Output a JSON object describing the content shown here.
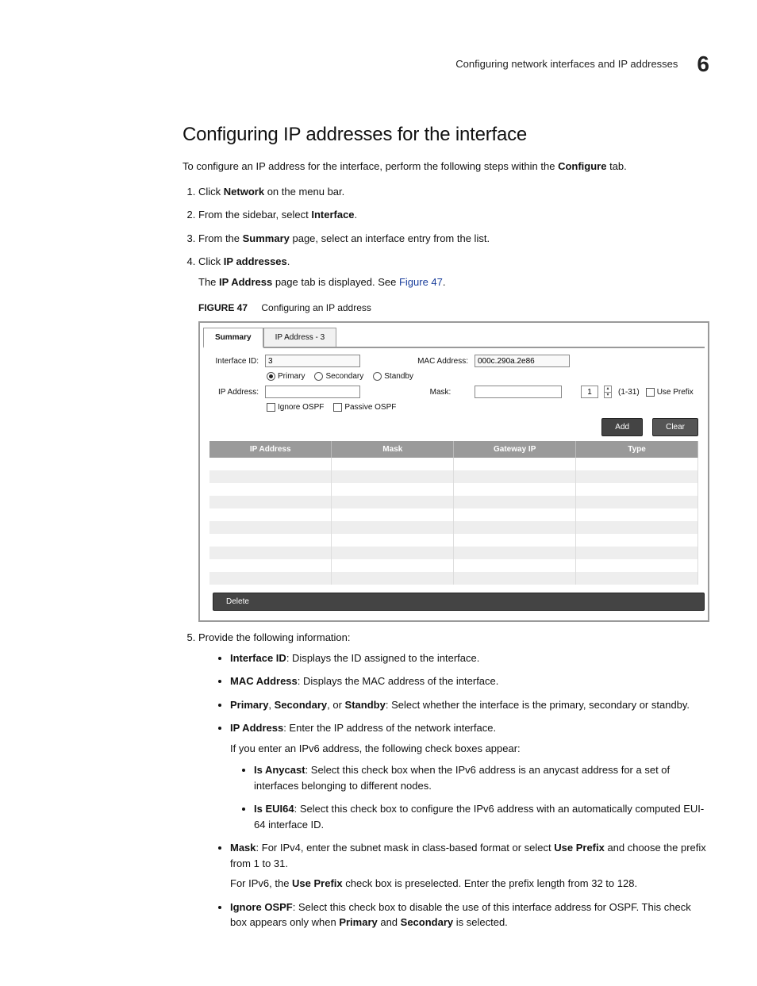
{
  "header": {
    "text": "Configuring network interfaces and IP addresses",
    "chapter": "6"
  },
  "section": {
    "title": "Configuring IP addresses for the interface"
  },
  "intro": {
    "pre": "To configure an IP address for the interface, perform the following steps within the ",
    "bold": "Configure",
    "post": " tab."
  },
  "steps": {
    "s1": {
      "pre": "Click ",
      "b": "Network",
      "post": " on the menu bar."
    },
    "s2": {
      "pre": "From the sidebar, select ",
      "b": "Interface",
      "post": "."
    },
    "s3": {
      "pre": "From the ",
      "b": "Summary",
      "post": " page, select an interface entry from the list."
    },
    "s4": {
      "pre": "Click ",
      "b": "IP addresses",
      "post": ".",
      "sub_pre": "The ",
      "sub_b": "IP Address",
      "sub_mid": " page tab is displayed. See ",
      "sub_link": "Figure 47",
      "sub_post": "."
    },
    "figcap": {
      "label": "FIGURE 47",
      "text": "Configuring an IP address"
    },
    "s5": {
      "intro": "Provide the following information:"
    }
  },
  "figure": {
    "tabs": {
      "summary": "Summary",
      "ip": "IP Address - 3"
    },
    "labels": {
      "interfaceId": "Interface ID:",
      "macAddress": "MAC Address:",
      "ipAddress": "IP Address:",
      "mask": "Mask:",
      "range": "(1-31)",
      "usePrefix": "Use Prefix",
      "ignoreOspf": "Ignore OSPF",
      "passiveOspf": "Passive OSPF",
      "primary": "Primary",
      "secondary": "Secondary",
      "standby": "Standby",
      "spinnerVal": "1"
    },
    "values": {
      "interfaceId": "3",
      "mac": "000c.290a.2e86",
      "ip": "",
      "mask": ""
    },
    "buttons": {
      "add": "Add",
      "clear": "Clear",
      "delete": "Delete"
    },
    "table": {
      "cols": [
        "IP Address",
        "Mask",
        "Gateway IP",
        "Type"
      ]
    }
  },
  "bullets": {
    "b1": {
      "b": "Interface ID",
      "t": ": Displays the ID assigned to the interface."
    },
    "b2": {
      "b": "MAC Address",
      "t": ": Displays the MAC address of the interface."
    },
    "b3": {
      "b1": "Primary",
      "sep1": ", ",
      "b2": "Secondary",
      "sep2": ", or ",
      "b3": "Standby",
      "t": ": Select whether the interface is the primary, secondary or standby."
    },
    "b4": {
      "b": "IP Address",
      "t": ": Enter the IP address of the network interface.",
      "sub": "If you enter an IPv6 address, the following check boxes appear:"
    },
    "b4a": {
      "b": "Is Anycast",
      "t": ": Select this check box when the IPv6 address is an anycast address for a set of interfaces belonging to different nodes."
    },
    "b4b": {
      "b": "Is EUI64",
      "t": ": Select this check box to configure the IPv6 address with an automatically computed EUI-64 interface ID."
    },
    "b5": {
      "b": "Mask",
      "t1": ": For IPv4, enter the subnet mask in class-based format or select ",
      "b2": "Use Prefix",
      "t2": " and choose the prefix from 1 to 31.",
      "sub1": "For IPv6, the ",
      "subb": "Use Prefix",
      "sub2": " check box is preselected. Enter the prefix length from 32 to 128."
    },
    "b6": {
      "b": "Ignore OSPF",
      "t1": ": Select this check box to disable the use of this interface address for OSPF. This check box appears only when ",
      "b2": "Primary",
      "mid": " and ",
      "b3": "Secondary",
      "t2": " is selected."
    }
  }
}
